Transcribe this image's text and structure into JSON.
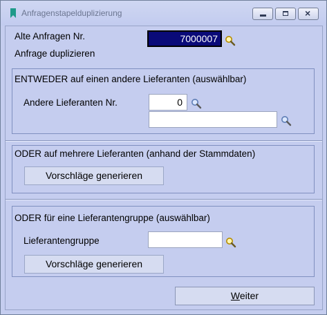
{
  "window": {
    "title": "Anfragenstapelduplizierung"
  },
  "fields": {
    "old_request_label": "Alte Anfragen Nr.",
    "old_request_value": "7000007",
    "duplicate_label": "Anfrage duplizieren"
  },
  "section_either": {
    "title": "ENTWEDER auf einen andere Lieferanten (auswählbar)",
    "supplier_label": "Andere Lieferanten Nr.",
    "supplier_value": "0",
    "supplier_name_value": ""
  },
  "section_multiple": {
    "title": "ODER auf mehrere Lieferanten (anhand der Stammdaten)",
    "generate_label": "Vorschläge generieren"
  },
  "section_group": {
    "title": "ODER für eine Lieferantengruppe (auswählbar)",
    "group_label": "Lieferantengruppe",
    "group_value": "",
    "generate_label": "Vorschläge generieren"
  },
  "footer": {
    "next_accel": "W",
    "next_rest": "eiter"
  },
  "colors": {
    "background": "#c5cdef",
    "selection": "#0a0a78"
  }
}
